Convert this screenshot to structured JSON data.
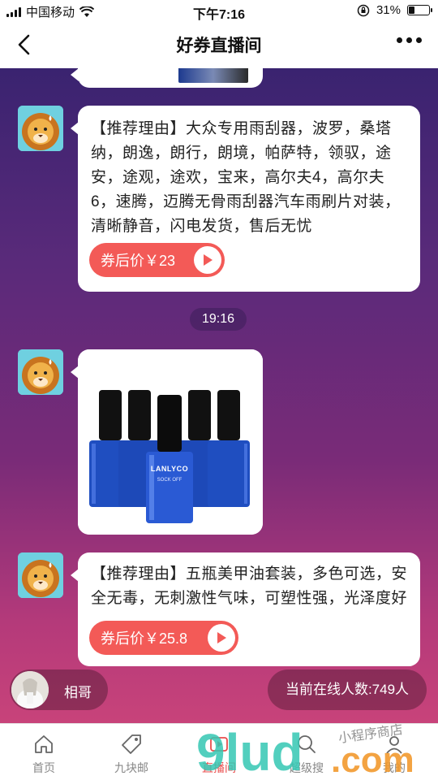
{
  "status_bar": {
    "carrier": "中国移动",
    "time": "下午7:16",
    "battery": "31%",
    "battery_level": 0.31
  },
  "nav": {
    "title": "好券直播间"
  },
  "messages": [
    {
      "reason": "【推荐理由】大众专用雨刮器，波罗，桑塔纳，朗逸，朗行，朗境，帕萨特，领驭，途安，途观，途欢，宝来，高尔夫4，高尔夫6，速腾，迈腾无骨雨刮器汽车雨刷片对装，清晰静音，闪电发货，售后无忧",
      "price": "券后价￥23"
    },
    {
      "reason": "【推荐理由】五瓶美甲油套装，多色可选，安全无毒，无刺激性气味，可塑性强，光泽度好",
      "price": "券后价￥25.8"
    }
  ],
  "time_divider": "19:16",
  "product_image": {
    "brand": "LANLYCO",
    "subtext": "SOCK OFF"
  },
  "host": {
    "name": "相哥"
  },
  "online": {
    "text": "当前在线人数:749人"
  },
  "tabs": [
    {
      "label": "首页",
      "icon": "home-icon"
    },
    {
      "label": "九块邮",
      "icon": "tag-icon"
    },
    {
      "label": "直播间",
      "icon": "live-icon"
    },
    {
      "label": "超级搜",
      "icon": "search-icon"
    },
    {
      "label": "我的",
      "icon": "user-icon"
    }
  ],
  "colors": {
    "accent": "#f35a57",
    "gradient_top": "#3a2370",
    "gradient_bottom": "#c8437a"
  },
  "watermark": {
    "text": "9lud.com",
    "sub": "小程序商店"
  }
}
